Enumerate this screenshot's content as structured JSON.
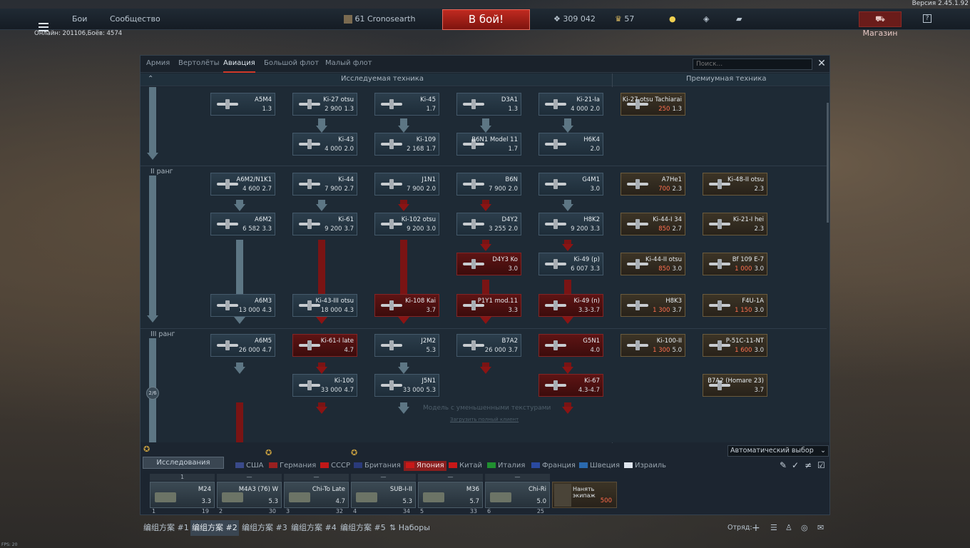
{
  "version": "Версия 2.45.1.92",
  "online": "Онлайн: 201106,Боёв: 4574",
  "topbar": {
    "battles": "Бои",
    "community": "Сообщество",
    "level": "61",
    "nickname": "Cronosearth",
    "battle_button": "В бой!",
    "silver": "309 042",
    "gold": "57",
    "shop": "Магазин",
    "help": "?"
  },
  "tabs": [
    "Армия",
    "Вертолёты",
    "Авиация",
    "Большой флот",
    "Малый флот"
  ],
  "search": {
    "placeholder": "Поиск..."
  },
  "headers": {
    "researched": "Исследуемая техника",
    "premium": "Премиумная техника"
  },
  "ranks": {
    "r2": "II ранг",
    "r3": "III ранг",
    "progress": "2/6"
  },
  "watermark": {
    "line1": "Модель с уменьшенными текстурами",
    "line2": "Загрузить полный клиент"
  },
  "cards": [
    {
      "name": "A5M4",
      "cost": "",
      "br": "1.3"
    },
    {
      "name": "Ki-27 otsu",
      "cost": "2 900",
      "br": "1.3"
    },
    {
      "name": "Ki-45",
      "cost": "",
      "br": "1.7"
    },
    {
      "name": "D3A1",
      "cost": "",
      "br": "1.3"
    },
    {
      "name": "Ki-21-Ia",
      "cost": "4 000",
      "br": "2.0"
    },
    {
      "name": "Ki-43",
      "cost": "4 000",
      "br": "2.0"
    },
    {
      "name": "Ki-109",
      "cost": "2 168",
      "br": "1.7"
    },
    {
      "name": "B6N1 Model 11",
      "cost": "",
      "br": "1.7"
    },
    {
      "name": "H6K4",
      "cost": "",
      "br": "2.0"
    },
    {
      "name": "A6M2/N1K1",
      "cost": "4 600",
      "br": "2.7"
    },
    {
      "name": "Ki-44",
      "cost": "7 900",
      "br": "2.7"
    },
    {
      "name": "J1N1",
      "cost": "7 900",
      "br": "2.0"
    },
    {
      "name": "B6N",
      "cost": "7 900",
      "br": "2.0"
    },
    {
      "name": "G4M1",
      "cost": "",
      "br": "3.0"
    },
    {
      "name": "A6M2",
      "cost": "6 582",
      "br": "3.3"
    },
    {
      "name": "Ki-61",
      "cost": "9 200",
      "br": "3.7"
    },
    {
      "name": "Ki-102 otsu",
      "cost": "9 200",
      "br": "3.0"
    },
    {
      "name": "D4Y2",
      "cost": "3 255",
      "br": "2.0"
    },
    {
      "name": "H8K2",
      "cost": "9 200",
      "br": "3.3"
    },
    {
      "name": "D4Y3 Ko",
      "cost": "",
      "br": "3.0"
    },
    {
      "name": "Ki-49 (p)",
      "cost": "6 007",
      "br": "3.3"
    },
    {
      "name": "A6M3",
      "cost": "13 000",
      "br": "4.3"
    },
    {
      "name": "Ki-43-III otsu",
      "cost": "18 000",
      "br": "4.3"
    },
    {
      "name": "Ki-108 Kai",
      "cost": "",
      "br": "3.7"
    },
    {
      "name": "P1Y1 mod.11",
      "cost": "",
      "br": "3.3"
    },
    {
      "name": "Ki-49 (n)",
      "cost": "",
      "br": "3.3-3.7"
    },
    {
      "name": "A6M5",
      "cost": "26 000",
      "br": "4.7"
    },
    {
      "name": "Ki-61-I late",
      "cost": "",
      "br": "4.7"
    },
    {
      "name": "J2M2",
      "cost": "",
      "br": "5.3"
    },
    {
      "name": "B7A2",
      "cost": "26 000",
      "br": "3.7"
    },
    {
      "name": "G5N1",
      "cost": "",
      "br": "4.0"
    },
    {
      "name": "Ki-100",
      "cost": "33 000",
      "br": "4.7"
    },
    {
      "name": "J5N1",
      "cost": "33 000",
      "br": "5.3"
    },
    {
      "name": "Ki-67",
      "cost": "",
      "br": "4.3-4.7"
    }
  ],
  "premium": [
    {
      "name": "Ki-27 otsu Tachiarai",
      "cost": "250",
      "br": "1.3"
    },
    {
      "name": "A7He1",
      "cost": "700",
      "br": "2.3"
    },
    {
      "name": "Ki-48-II otsu",
      "cost": "",
      "br": "2.3"
    },
    {
      "name": "Ki-44-I 34",
      "cost": "850",
      "br": "2.7"
    },
    {
      "name": "Ki-21-I hei",
      "cost": "",
      "br": "2.3"
    },
    {
      "name": "Ki-44-II otsu",
      "cost": "850",
      "br": "3.0"
    },
    {
      "name": "Bf 109 E-7",
      "cost": "1 000",
      "br": "3.0"
    },
    {
      "name": "H8K3",
      "cost": "1 300",
      "br": "3.7"
    },
    {
      "name": "F4U-1A",
      "cost": "1 150",
      "br": "3.0"
    },
    {
      "name": "Ki-100-II",
      "cost": "1 300",
      "br": "5.0"
    },
    {
      "name": "P-51C-11-NT",
      "cost": "1 600",
      "br": "3.0"
    },
    {
      "name": "B7A2 (Homare 23)",
      "cost": "",
      "br": "3.7"
    }
  ],
  "bottom": {
    "auto_select": "Автоматический выбор",
    "research": "Исследования",
    "countries": [
      "США",
      "Германия",
      "СССР",
      "Британия",
      "Япония",
      "Китай",
      "Италия",
      "Франция",
      "Швеция",
      "Израиль"
    ],
    "crew": [
      {
        "top": "1",
        "name": "M24",
        "br": "3.3",
        "num": "1",
        "lvl": "19"
      },
      {
        "top": "—",
        "name": "M4A3 (76) W",
        "br": "5.3",
        "num": "2",
        "lvl": "30"
      },
      {
        "top": "—",
        "name": "Chi-To Late",
        "br": "4.7",
        "num": "3",
        "lvl": "32"
      },
      {
        "top": "—",
        "name": "SUB-I-II",
        "br": "5.3",
        "num": "4",
        "lvl": "34"
      },
      {
        "top": "—",
        "name": "M36",
        "br": "5.7",
        "num": "5",
        "lvl": "33"
      },
      {
        "top": "—",
        "name": "Chi-Ri",
        "br": "5.0",
        "num": "6",
        "lvl": "25"
      }
    ],
    "hire": "Нанять экипаж",
    "hire_cost": "500",
    "presets": [
      "编组方案 #1",
      "编组方案 #2",
      "编组方案 #3",
      "编组方案 #4",
      "编组方案 #5",
      "Наборы"
    ],
    "squad": "Отряд:",
    "fps": "FPS: 20"
  }
}
